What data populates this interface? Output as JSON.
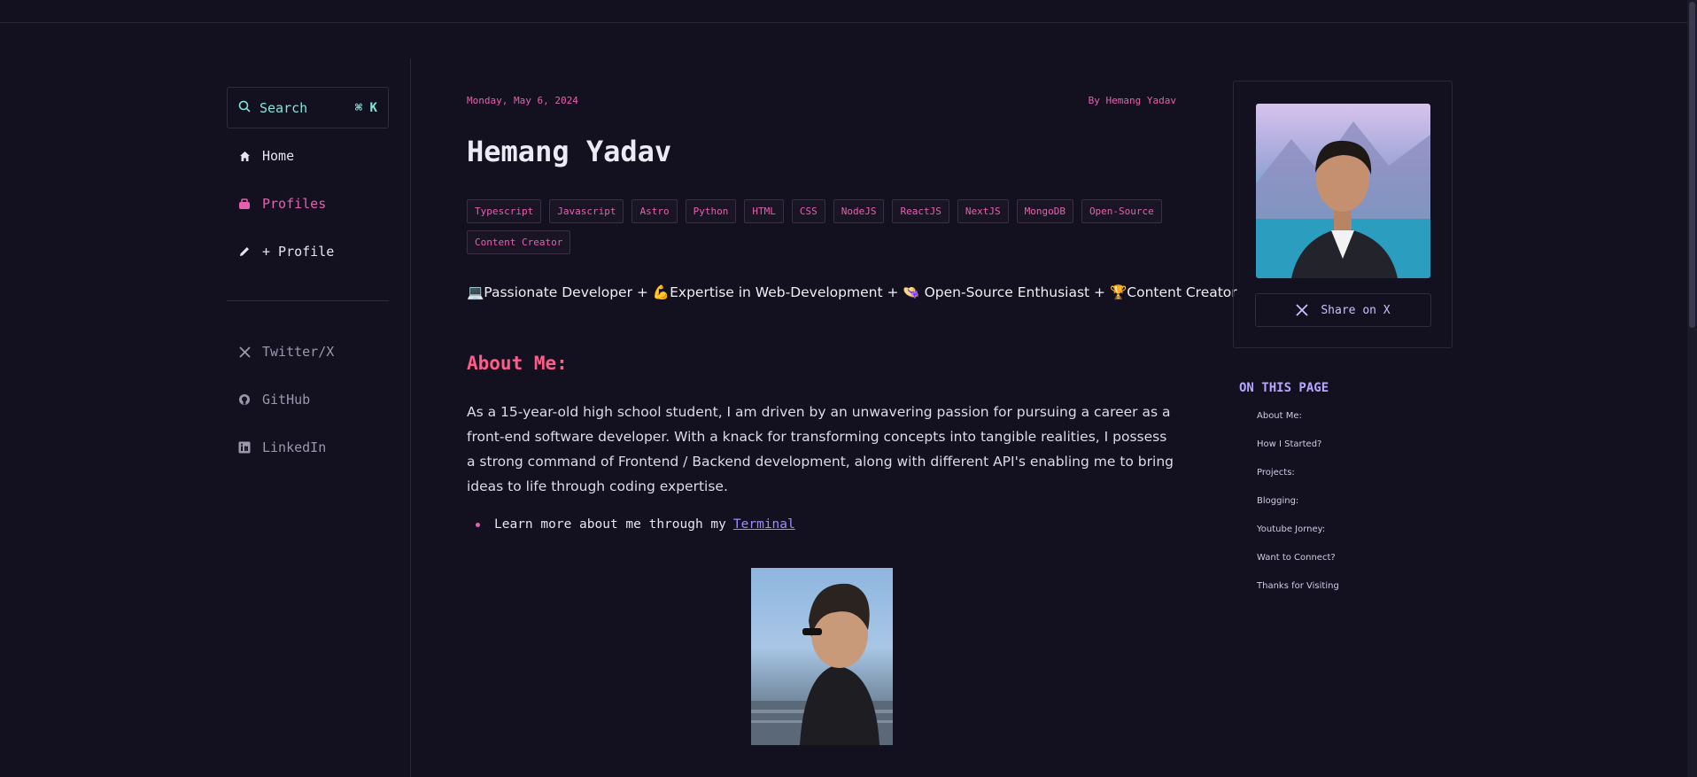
{
  "sidebar": {
    "search": {
      "label": "Search",
      "shortcut": "⌘ K"
    },
    "nav": [
      {
        "label": "Home",
        "icon": "home-icon"
      },
      {
        "label": "Profiles",
        "icon": "profiles-icon",
        "active": true
      },
      {
        "label": "+ Profile",
        "icon": "pencil-icon"
      }
    ],
    "social": [
      {
        "label": "Twitter/X",
        "icon": "x-logo-icon"
      },
      {
        "label": "GitHub",
        "icon": "github-icon"
      },
      {
        "label": "LinkedIn",
        "icon": "linkedin-icon"
      }
    ]
  },
  "post": {
    "date": "Monday, May 6, 2024",
    "author": "By Hemang Yadav",
    "title": "Hemang Yadav",
    "tags": [
      "Typescript",
      "Javascript",
      "Astro",
      "Python",
      "HTML",
      "CSS",
      "NodeJS",
      "ReactJS",
      "NextJS",
      "MongoDB",
      "Open-Source",
      "Content Creator"
    ],
    "tagline": "💻Passionate Developer + 💪Expertise in Web-Development + 👒 Open-Source Enthusiast + 🏆Content Creator",
    "about_heading": "About Me:",
    "about_text": "As a 15-year-old high school student, I am driven by an unwavering passion for pursuing a career as a front-end software developer. With a knack for transforming concepts into tangible realities, I possess a strong command of Frontend / Backend development, along with different API's enabling me to bring ideas to life through coding expertise.",
    "bullet_text": "Learn more about me through my",
    "bullet_link": "Terminal"
  },
  "aside": {
    "share_label": "Share on X",
    "toc_title": "ON THIS PAGE",
    "toc": [
      "About Me:",
      "How I Started?",
      "Projects:",
      "Blogging:",
      "Youtube Jorney:",
      "Want to Connect?",
      "Thanks for Visiting"
    ]
  },
  "colors": {
    "background": "#13111f",
    "accent_pink": "#e85fb0",
    "heading_pink": "#ff5c8a",
    "search_teal": "#7ee8dd",
    "toc_purple": "#b8a6ff"
  }
}
